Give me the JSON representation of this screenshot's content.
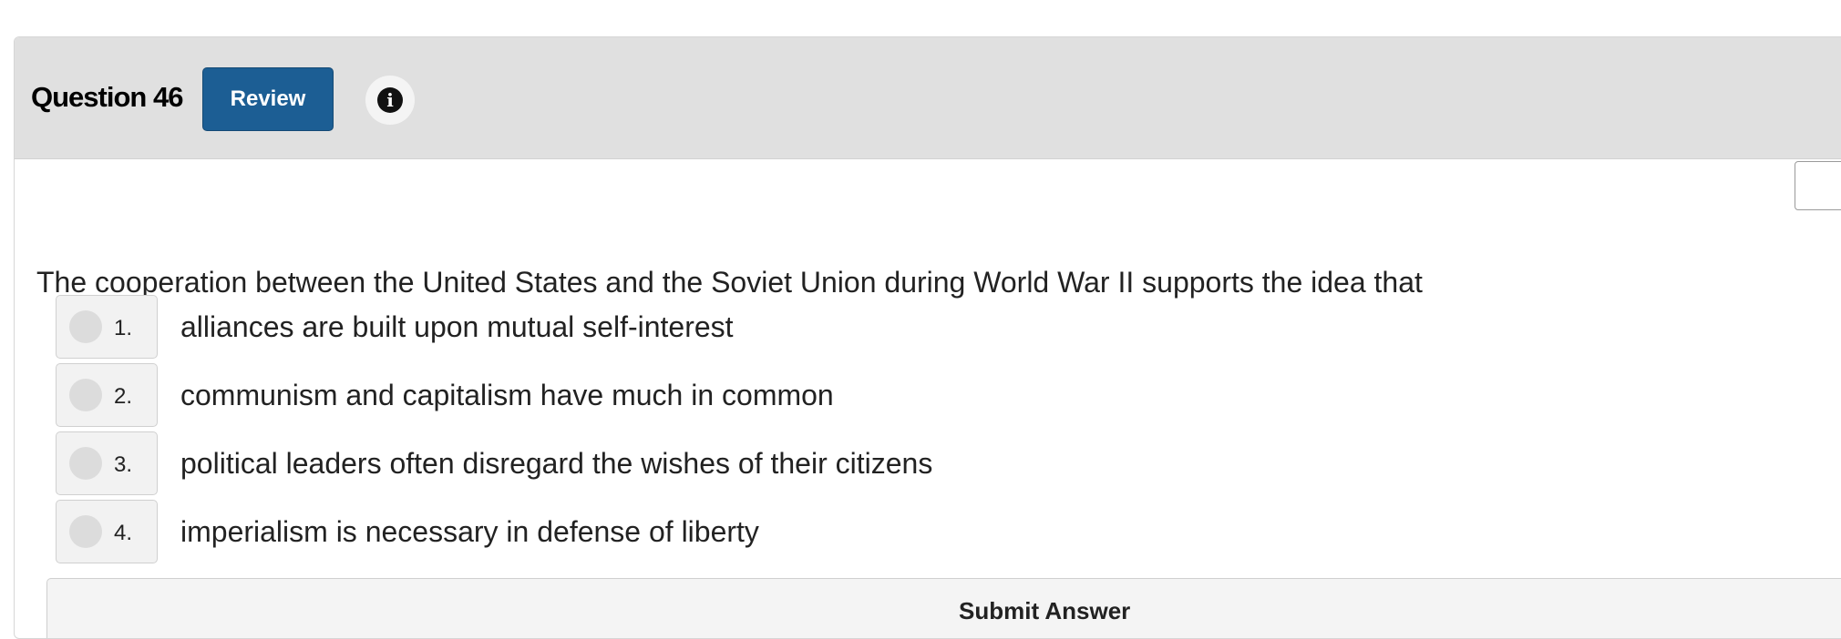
{
  "header": {
    "question_label": "Question 46",
    "review_label": "Review",
    "info_icon": "info-circle-icon"
  },
  "question": {
    "text": "The cooperation between the United States and the Soviet Union during World War II supports the idea that"
  },
  "choices": [
    {
      "number": "1.",
      "text": "alliances are built upon mutual self-interest"
    },
    {
      "number": "2.",
      "text": "communism and capitalism have much in common"
    },
    {
      "number": "3.",
      "text": "political leaders often disregard the wishes of their citizens"
    },
    {
      "number": "4.",
      "text": "imperialism is necessary in defense of liberty"
    }
  ],
  "submit": {
    "label": "Submit Answer"
  },
  "colors": {
    "header_bg": "#e0e0e0",
    "review_button": "#1c5e94",
    "choice_box_bg": "#f2f2f2"
  }
}
